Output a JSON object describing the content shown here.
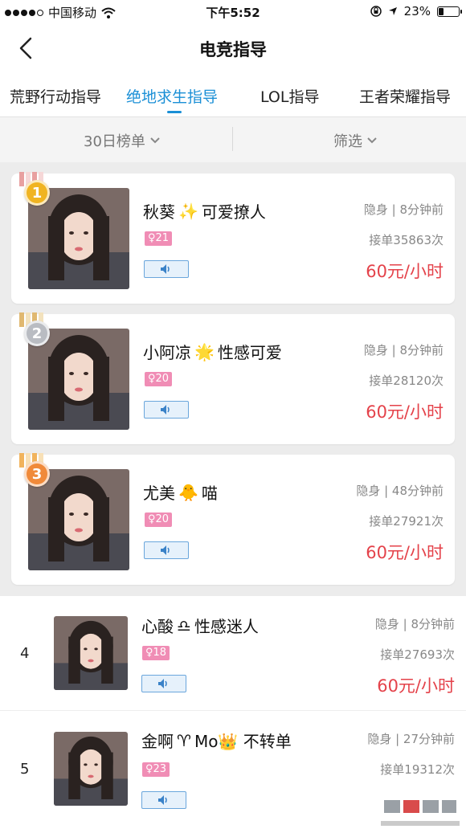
{
  "status_bar": {
    "carrier": "中国移动",
    "time": "下午5:52",
    "battery": "23%",
    "battery_level": 0.23
  },
  "nav": {
    "title": "电竞指导"
  },
  "tabs": [
    {
      "label": "荒野行动指导",
      "active": false
    },
    {
      "label": "绝地求生指导",
      "active": true
    },
    {
      "label": "LOL指导",
      "active": false
    },
    {
      "label": "王者荣耀指导",
      "active": false
    }
  ],
  "filters": {
    "ranking": "30日榜单",
    "filter": "筛选"
  },
  "players": [
    {
      "rank": "1",
      "name": "秋葵",
      "emoji": "✨",
      "tagline": "可爱撩人",
      "gender": "♀21",
      "status": "隐身 | 8分钟前",
      "orders": "接单35863次",
      "price": "60元/小时"
    },
    {
      "rank": "2",
      "name": "小阿凉",
      "emoji": "🌟",
      "tagline": "性感可爱",
      "gender": "♀20",
      "status": "隐身 | 8分钟前",
      "orders": "接单28120次",
      "price": "60元/小时"
    },
    {
      "rank": "3",
      "name": "尤美",
      "emoji": "🐥",
      "tagline": "喵",
      "gender": "♀20",
      "status": "隐身 | 48分钟前",
      "orders": "接单27921次",
      "price": "60元/小时"
    },
    {
      "rank": "4",
      "name": "心酸",
      "emoji": "♎",
      "tagline": "性感迷人",
      "gender": "♀18",
      "status": "隐身 | 8分钟前",
      "orders": "接单27693次",
      "price": "60元/小时"
    },
    {
      "rank": "5",
      "name": "金啊",
      "emoji": "♈",
      "tagline": "Mo👑 不转单",
      "gender": "♀23",
      "status": "隐身 | 27分钟前",
      "orders": "接单19312次",
      "price": ""
    }
  ],
  "colors": {
    "accent": "#1a8fd6",
    "price": "#e4424a",
    "gender_badge": "#f08db5"
  },
  "medal_colors": [
    "#f0b422",
    "#b9bcc2",
    "#f08a3a"
  ]
}
